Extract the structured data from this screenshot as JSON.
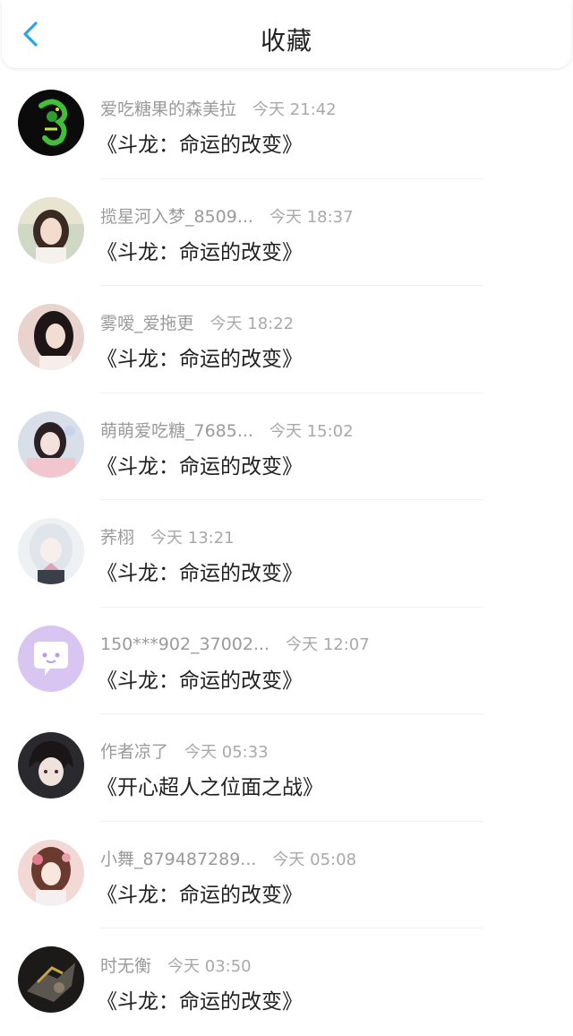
{
  "header": {
    "title": "收藏",
    "back_icon": "chevron-left-icon",
    "accent": "#2aa6e6"
  },
  "items": [
    {
      "username": "爱吃糖果的森美拉",
      "time": "今天 21:42",
      "book": "《斗龙：命运的改变》",
      "avatar": "dragon-avatar"
    },
    {
      "username": "揽星河入梦_8509...",
      "time": "今天 18:37",
      "book": "《斗龙：命运的改变》",
      "avatar": "girl-photo-avatar"
    },
    {
      "username": "雾嗳_爱拖更",
      "time": "今天 18:22",
      "book": "《斗龙：命运的改变》",
      "avatar": "girl-photo-avatar"
    },
    {
      "username": "萌萌爱吃糖_7685...",
      "time": "今天 15:02",
      "book": "《斗龙：命运的改变》",
      "avatar": "girl-photo-avatar"
    },
    {
      "username": "荞栩",
      "time": "今天 13:21",
      "book": "《斗龙：命运的改变》",
      "avatar": "anime-girl-avatar"
    },
    {
      "username": "150***902_37002...",
      "time": "今天 12:07",
      "book": "《斗龙：命运的改变》",
      "avatar": "chat-bubble-avatar"
    },
    {
      "username": "作者凉了",
      "time": "今天 05:33",
      "book": "《开心超人之位面之战》",
      "avatar": "anime-boy-avatar"
    },
    {
      "username": "小舞_879487289...",
      "time": "今天 05:08",
      "book": "《斗龙：命运的改变》",
      "avatar": "anime-girl-avatar"
    },
    {
      "username": "时无衡",
      "time": "今天 03:50",
      "book": "《斗龙：命运的改变》",
      "avatar": "armor-avatar"
    }
  ]
}
